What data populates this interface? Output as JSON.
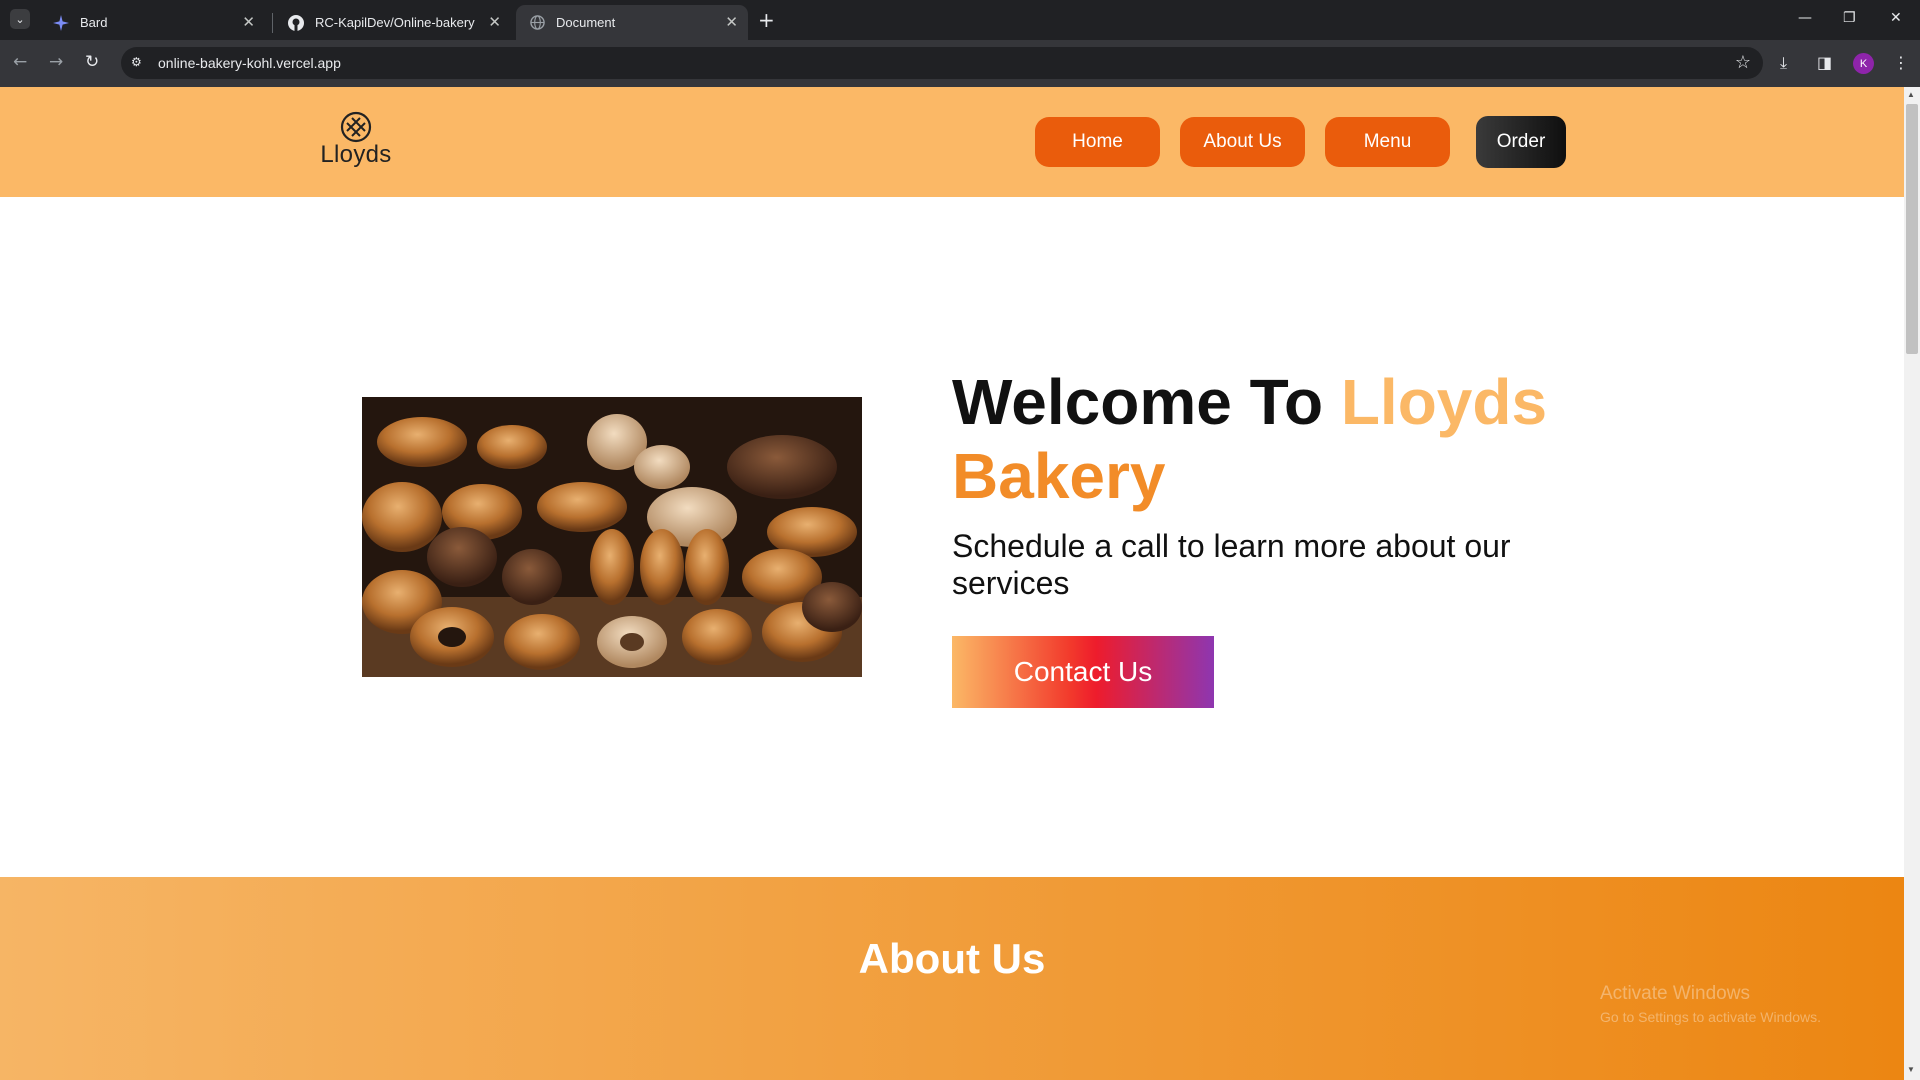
{
  "browser": {
    "tabs": [
      {
        "title": "Bard",
        "icon": "sparkle-icon"
      },
      {
        "title": "RC-KapilDev/Online-bakery",
        "icon": "github-icon"
      },
      {
        "title": "Document",
        "icon": "globe-icon"
      }
    ],
    "url": "online-bakery-kohl.vercel.app",
    "profile_initial": "K"
  },
  "site": {
    "logo_text": "Lloyds",
    "nav": [
      {
        "label": "Home"
      },
      {
        "label": "About Us"
      },
      {
        "label": "Menu"
      }
    ],
    "order_label": "Order",
    "hero": {
      "title_prefix": "Welcome To ",
      "title_accent1": "Lloyds",
      "title_accent2": "Bakery",
      "subtitle": "Schedule a call to learn more about our services",
      "cta_label": "Contact Us"
    },
    "about_heading": "About Us"
  },
  "os": {
    "watermark_title": "Activate Windows",
    "watermark_sub": "Go to Settings to activate Windows."
  },
  "colors": {
    "header_bg": "#fbb866",
    "nav_pill": "#ea5c0c",
    "accent_light": "#fbb866",
    "accent_dark": "#f28c28"
  }
}
